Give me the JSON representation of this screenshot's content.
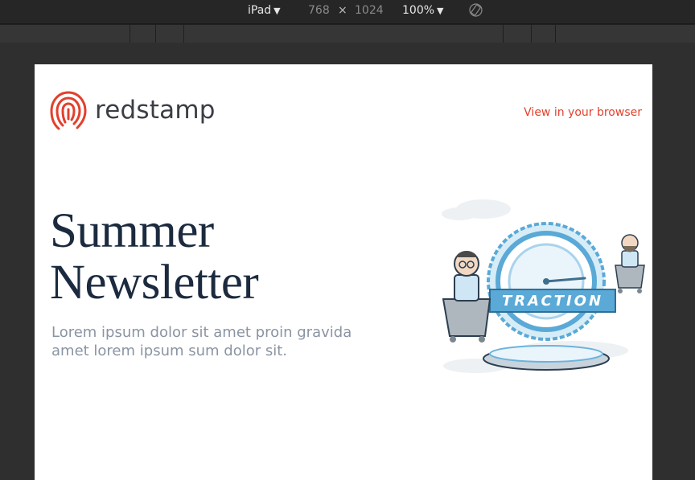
{
  "toolbar": {
    "device": "iPad",
    "width": "768",
    "times": "×",
    "height": "1024",
    "zoom": "100%",
    "rotate_icon": "rotate-device-icon"
  },
  "email": {
    "brand_name": "redstamp",
    "logo_icon": "fingerprint-logo",
    "view_in_browser": "View in your browser",
    "hero": {
      "title_line1": "Summer",
      "title_line2": "Newsletter",
      "subtitle": "Lorem ipsum dolor sit amet proin gravida amet lorem ipsum sum dolor sit."
    },
    "illustration": {
      "badge_text": "TRACTION"
    }
  },
  "colors": {
    "accent": "#e2402d",
    "title": "#1b2a3e",
    "subtitle": "#8a94a3",
    "illustration_blue": "#5aa9d6"
  }
}
